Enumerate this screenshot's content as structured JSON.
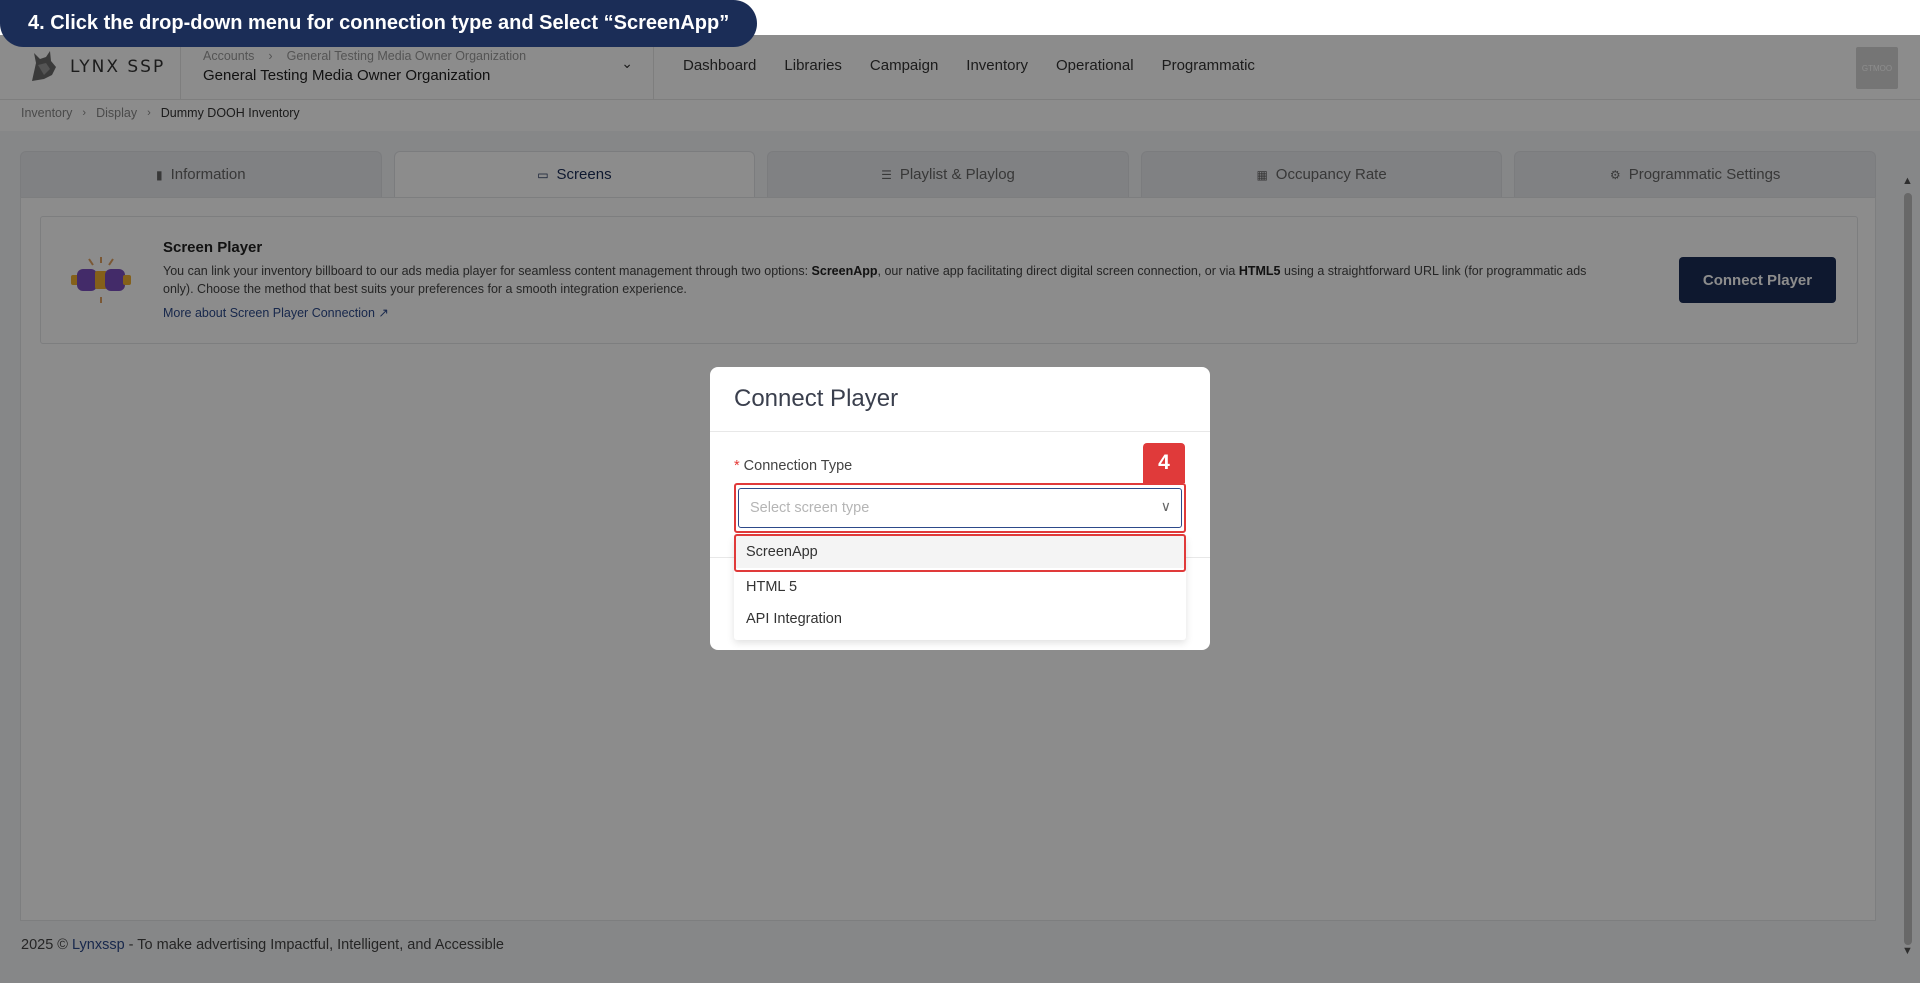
{
  "instruction": {
    "text": "4. Click the drop-down menu for connection type and Select “ScreenApp”",
    "step_badge": "4"
  },
  "header": {
    "logo_text": "LYNX SSP",
    "org_crumb": [
      "Accounts",
      "General Testing Media Owner Organization"
    ],
    "org_name": "General Testing Media Owner Organization",
    "nav": [
      "Dashboard",
      "Libraries",
      "Campaign",
      "Inventory",
      "Operational",
      "Programmatic"
    ],
    "avatar_text": "GTMOO"
  },
  "breadcrumb": [
    "Inventory",
    "Display",
    "Dummy DOOH Inventory"
  ],
  "tabs": [
    {
      "label": "Information",
      "icon": "file-icon",
      "active": false
    },
    {
      "label": "Screens",
      "icon": "monitor-icon",
      "active": true
    },
    {
      "label": "Playlist & Playlog",
      "icon": "list-icon",
      "active": false
    },
    {
      "label": "Occupancy Rate",
      "icon": "chart-icon",
      "active": false
    },
    {
      "label": "Programmatic Settings",
      "icon": "settings-icon",
      "active": false
    }
  ],
  "screen_player": {
    "title": "Screen Player",
    "desc_1": "You can link your inventory billboard to our ads media player for seamless content management through two options: ",
    "desc_bold_1": "ScreenApp",
    "desc_2": ", our native app facilitating direct digital screen connection, or via ",
    "desc_bold_2": "HTML5",
    "desc_3": " using a straightforward URL link (for programmatic ads only). Choose the method that best suits your preferences for a smooth integration experience.",
    "link": "More about Screen Player Connection ↗",
    "button": "Connect Player"
  },
  "modal": {
    "title": "Connect Player",
    "field_label": "Connection Type",
    "required_mark": "*",
    "placeholder": "Select screen type",
    "options": [
      "ScreenApp",
      "HTML 5",
      "API Integration"
    ],
    "highlighted_option": "ScreenApp"
  },
  "footer": {
    "prefix": "2025 © ",
    "brand": "Lynxssp",
    "suffix": " - To make advertising Impactful, Intelligent, and Accessible"
  },
  "colors": {
    "brand_navy": "#1b2d57",
    "highlight_red": "#e03a3a",
    "overlay": "rgba(0,0,0,0.45)"
  }
}
